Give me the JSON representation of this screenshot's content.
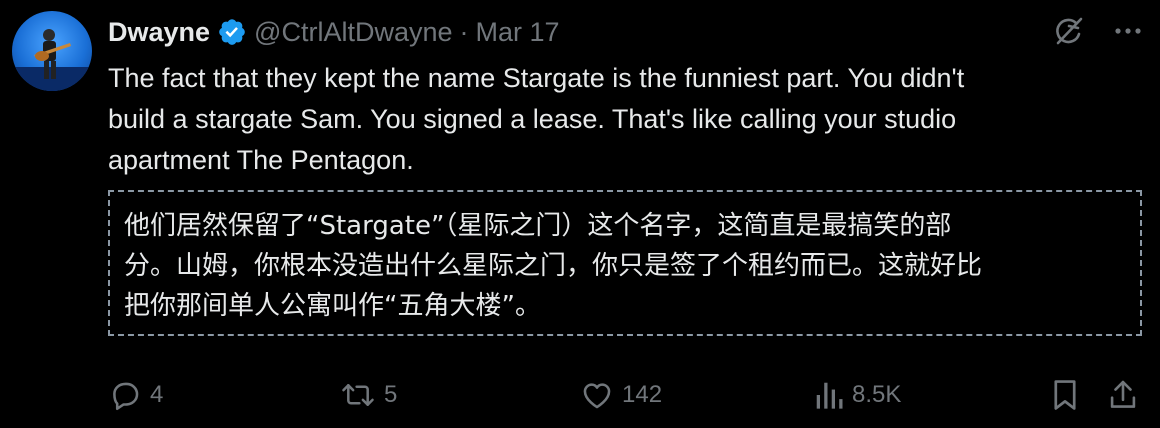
{
  "user": {
    "name": "Dwayne",
    "handle": "@CtrlAltDwayne",
    "separator": "·",
    "date": "Mar 17"
  },
  "tweet": {
    "lines": [
      "The fact that they kept the name Stargate is the funniest part. You didn't",
      "build a stargate Sam. You signed a lease. That's like calling your studio",
      "apartment The Pentagon."
    ]
  },
  "translation": {
    "lines": [
      "他们居然保留了“Stargate”（星际之门）这个名字，这简直是最搞笑的部",
      "分。山姆，你根本没造出什么星际之门，你只是签了个租约而已。这就好比",
      "把你那间单人公寓叫作“五角大楼”。"
    ]
  },
  "actions": {
    "replies": "4",
    "reposts": "5",
    "likes": "142",
    "views": "8.5K"
  },
  "icons": {
    "verified": "verified-badge-icon",
    "grok": "grok-icon",
    "more": "more-icon",
    "reply": "reply-icon",
    "repost": "repost-icon",
    "like": "heart-icon",
    "views": "views-icon",
    "bookmark": "bookmark-icon",
    "share": "share-icon"
  },
  "colors": {
    "background": "#000000",
    "text": "#e7e9ea",
    "muted": "#71767b",
    "verified": "#1d9bf0"
  }
}
